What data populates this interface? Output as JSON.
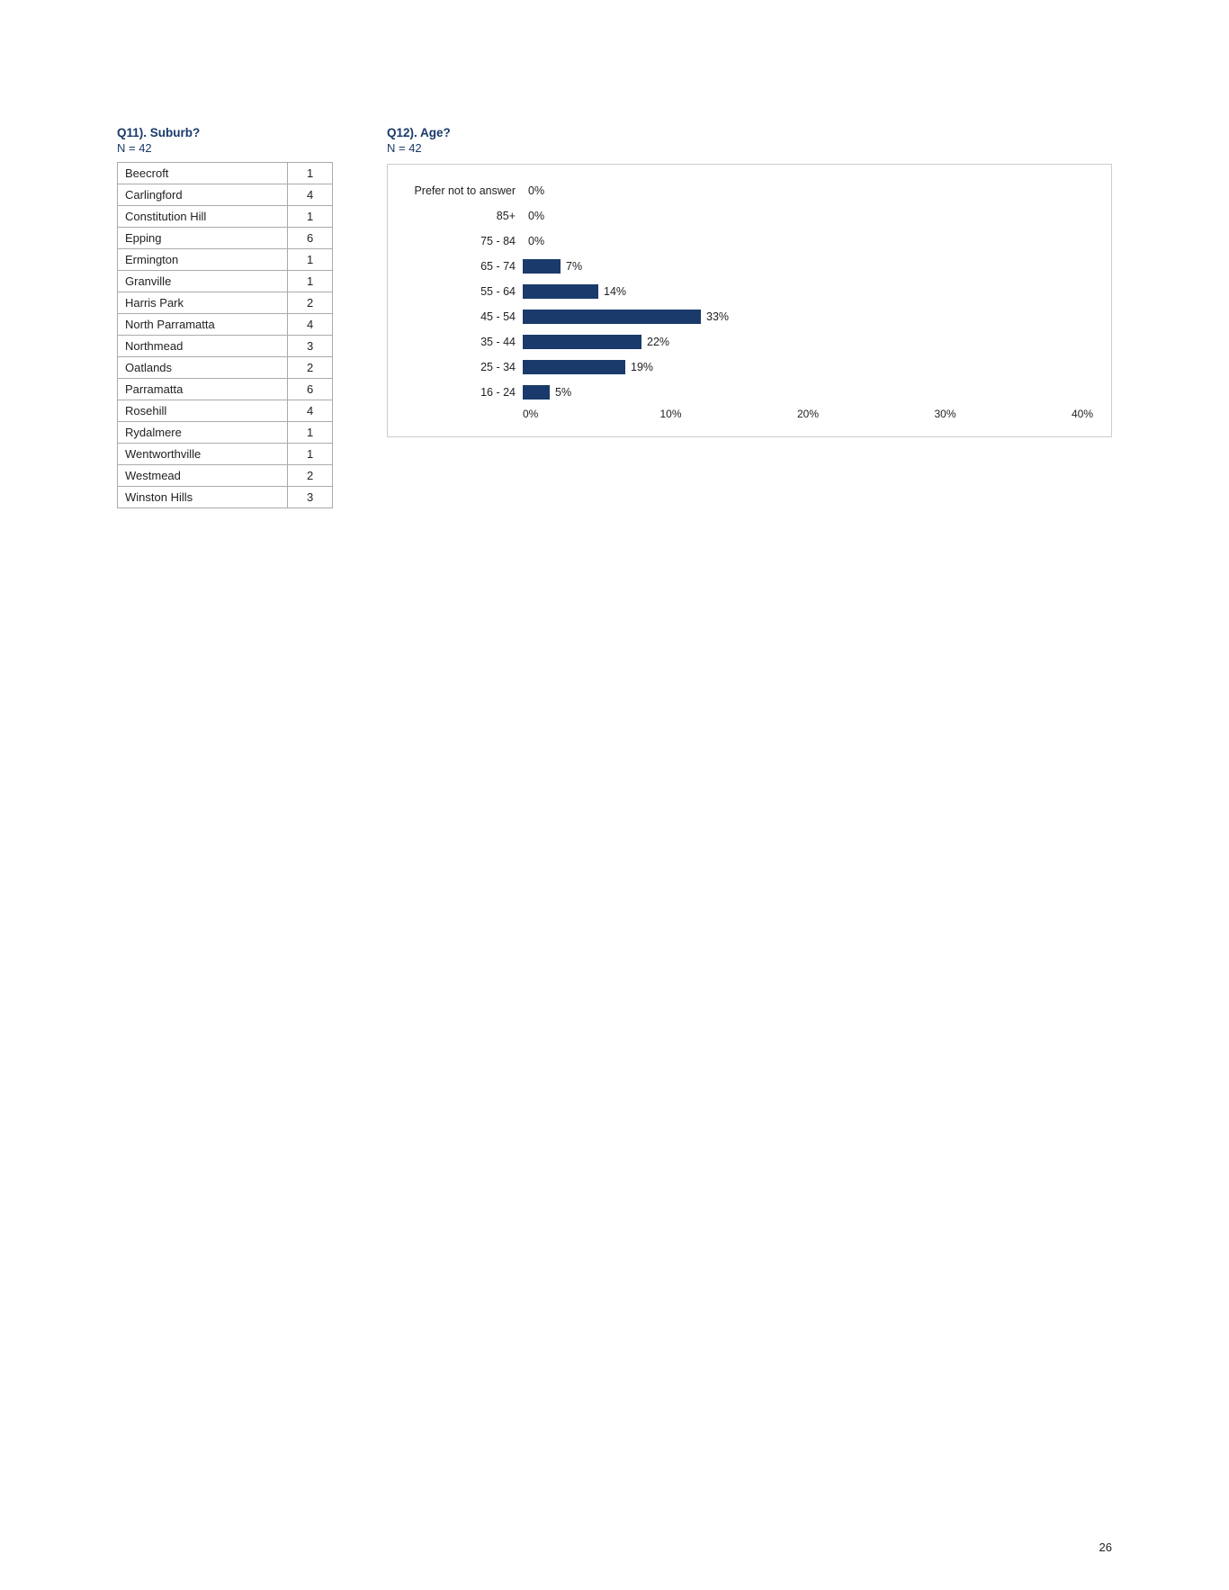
{
  "q11": {
    "title": "Q11). Suburb?",
    "n": "N = 42",
    "rows": [
      {
        "suburb": "Beecroft",
        "count": 1
      },
      {
        "suburb": "Carlingford",
        "count": 4
      },
      {
        "suburb": "Constitution Hill",
        "count": 1
      },
      {
        "suburb": "Epping",
        "count": 6
      },
      {
        "suburb": "Ermington",
        "count": 1
      },
      {
        "suburb": "Granville",
        "count": 1
      },
      {
        "suburb": "Harris Park",
        "count": 2
      },
      {
        "suburb": "North Parramatta",
        "count": 4
      },
      {
        "suburb": "Northmead",
        "count": 3
      },
      {
        "suburb": "Oatlands",
        "count": 2
      },
      {
        "suburb": "Parramatta",
        "count": 6
      },
      {
        "suburb": "Rosehill",
        "count": 4
      },
      {
        "suburb": "Rydalmere",
        "count": 1
      },
      {
        "suburb": "Wentworthville",
        "count": 1
      },
      {
        "suburb": "Westmead",
        "count": 2
      },
      {
        "suburb": "Winston Hills",
        "count": 3
      }
    ]
  },
  "q12": {
    "title": "Q12). Age?",
    "n": "N = 42",
    "bars": [
      {
        "label": "Prefer not to answer",
        "pct": 0,
        "display": "0%"
      },
      {
        "label": "85+",
        "pct": 0,
        "display": "0%"
      },
      {
        "label": "75 - 84",
        "pct": 0,
        "display": "0%"
      },
      {
        "label": "65 - 74",
        "pct": 7,
        "display": "7%"
      },
      {
        "label": "55 - 64",
        "pct": 14,
        "display": "14%"
      },
      {
        "label": "45 - 54",
        "pct": 33,
        "display": "33%"
      },
      {
        "label": "35 - 44",
        "pct": 22,
        "display": "22%"
      },
      {
        "label": "25 - 34",
        "pct": 19,
        "display": "19%"
      },
      {
        "label": "16 - 24",
        "pct": 5,
        "display": "5%"
      }
    ],
    "x_axis": [
      "0%",
      "10%",
      "20%",
      "30%",
      "40%"
    ]
  },
  "page": {
    "number": "26"
  }
}
